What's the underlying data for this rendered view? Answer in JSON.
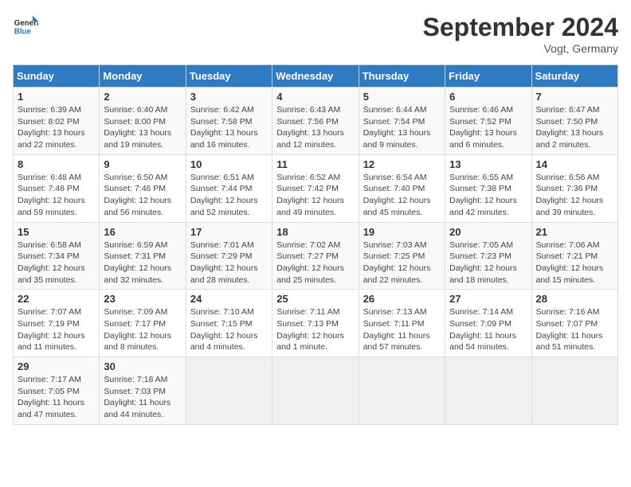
{
  "header": {
    "logo_line1": "General",
    "logo_line2": "Blue",
    "month": "September 2024",
    "location": "Vogt, Germany"
  },
  "weekdays": [
    "Sunday",
    "Monday",
    "Tuesday",
    "Wednesday",
    "Thursday",
    "Friday",
    "Saturday"
  ],
  "weeks": [
    [
      {
        "day": "1",
        "info": "Sunrise: 6:39 AM\nSunset: 8:02 PM\nDaylight: 13 hours\nand 22 minutes."
      },
      {
        "day": "2",
        "info": "Sunrise: 6:40 AM\nSunset: 8:00 PM\nDaylight: 13 hours\nand 19 minutes."
      },
      {
        "day": "3",
        "info": "Sunrise: 6:42 AM\nSunset: 7:58 PM\nDaylight: 13 hours\nand 16 minutes."
      },
      {
        "day": "4",
        "info": "Sunrise: 6:43 AM\nSunset: 7:56 PM\nDaylight: 13 hours\nand 12 minutes."
      },
      {
        "day": "5",
        "info": "Sunrise: 6:44 AM\nSunset: 7:54 PM\nDaylight: 13 hours\nand 9 minutes."
      },
      {
        "day": "6",
        "info": "Sunrise: 6:46 AM\nSunset: 7:52 PM\nDaylight: 13 hours\nand 6 minutes."
      },
      {
        "day": "7",
        "info": "Sunrise: 6:47 AM\nSunset: 7:50 PM\nDaylight: 13 hours\nand 2 minutes."
      }
    ],
    [
      {
        "day": "8",
        "info": "Sunrise: 6:48 AM\nSunset: 7:48 PM\nDaylight: 12 hours\nand 59 minutes."
      },
      {
        "day": "9",
        "info": "Sunrise: 6:50 AM\nSunset: 7:46 PM\nDaylight: 12 hours\nand 56 minutes."
      },
      {
        "day": "10",
        "info": "Sunrise: 6:51 AM\nSunset: 7:44 PM\nDaylight: 12 hours\nand 52 minutes."
      },
      {
        "day": "11",
        "info": "Sunrise: 6:52 AM\nSunset: 7:42 PM\nDaylight: 12 hours\nand 49 minutes."
      },
      {
        "day": "12",
        "info": "Sunrise: 6:54 AM\nSunset: 7:40 PM\nDaylight: 12 hours\nand 45 minutes."
      },
      {
        "day": "13",
        "info": "Sunrise: 6:55 AM\nSunset: 7:38 PM\nDaylight: 12 hours\nand 42 minutes."
      },
      {
        "day": "14",
        "info": "Sunrise: 6:56 AM\nSunset: 7:36 PM\nDaylight: 12 hours\nand 39 minutes."
      }
    ],
    [
      {
        "day": "15",
        "info": "Sunrise: 6:58 AM\nSunset: 7:34 PM\nDaylight: 12 hours\nand 35 minutes."
      },
      {
        "day": "16",
        "info": "Sunrise: 6:59 AM\nSunset: 7:31 PM\nDaylight: 12 hours\nand 32 minutes."
      },
      {
        "day": "17",
        "info": "Sunrise: 7:01 AM\nSunset: 7:29 PM\nDaylight: 12 hours\nand 28 minutes."
      },
      {
        "day": "18",
        "info": "Sunrise: 7:02 AM\nSunset: 7:27 PM\nDaylight: 12 hours\nand 25 minutes."
      },
      {
        "day": "19",
        "info": "Sunrise: 7:03 AM\nSunset: 7:25 PM\nDaylight: 12 hours\nand 22 minutes."
      },
      {
        "day": "20",
        "info": "Sunrise: 7:05 AM\nSunset: 7:23 PM\nDaylight: 12 hours\nand 18 minutes."
      },
      {
        "day": "21",
        "info": "Sunrise: 7:06 AM\nSunset: 7:21 PM\nDaylight: 12 hours\nand 15 minutes."
      }
    ],
    [
      {
        "day": "22",
        "info": "Sunrise: 7:07 AM\nSunset: 7:19 PM\nDaylight: 12 hours\nand 11 minutes."
      },
      {
        "day": "23",
        "info": "Sunrise: 7:09 AM\nSunset: 7:17 PM\nDaylight: 12 hours\nand 8 minutes."
      },
      {
        "day": "24",
        "info": "Sunrise: 7:10 AM\nSunset: 7:15 PM\nDaylight: 12 hours\nand 4 minutes."
      },
      {
        "day": "25",
        "info": "Sunrise: 7:11 AM\nSunset: 7:13 PM\nDaylight: 12 hours\nand 1 minute."
      },
      {
        "day": "26",
        "info": "Sunrise: 7:13 AM\nSunset: 7:11 PM\nDaylight: 11 hours\nand 57 minutes."
      },
      {
        "day": "27",
        "info": "Sunrise: 7:14 AM\nSunset: 7:09 PM\nDaylight: 11 hours\nand 54 minutes."
      },
      {
        "day": "28",
        "info": "Sunrise: 7:16 AM\nSunset: 7:07 PM\nDaylight: 11 hours\nand 51 minutes."
      }
    ],
    [
      {
        "day": "29",
        "info": "Sunrise: 7:17 AM\nSunset: 7:05 PM\nDaylight: 11 hours\nand 47 minutes."
      },
      {
        "day": "30",
        "info": "Sunrise: 7:18 AM\nSunset: 7:03 PM\nDaylight: 11 hours\nand 44 minutes."
      },
      {
        "day": "",
        "info": ""
      },
      {
        "day": "",
        "info": ""
      },
      {
        "day": "",
        "info": ""
      },
      {
        "day": "",
        "info": ""
      },
      {
        "day": "",
        "info": ""
      }
    ]
  ]
}
